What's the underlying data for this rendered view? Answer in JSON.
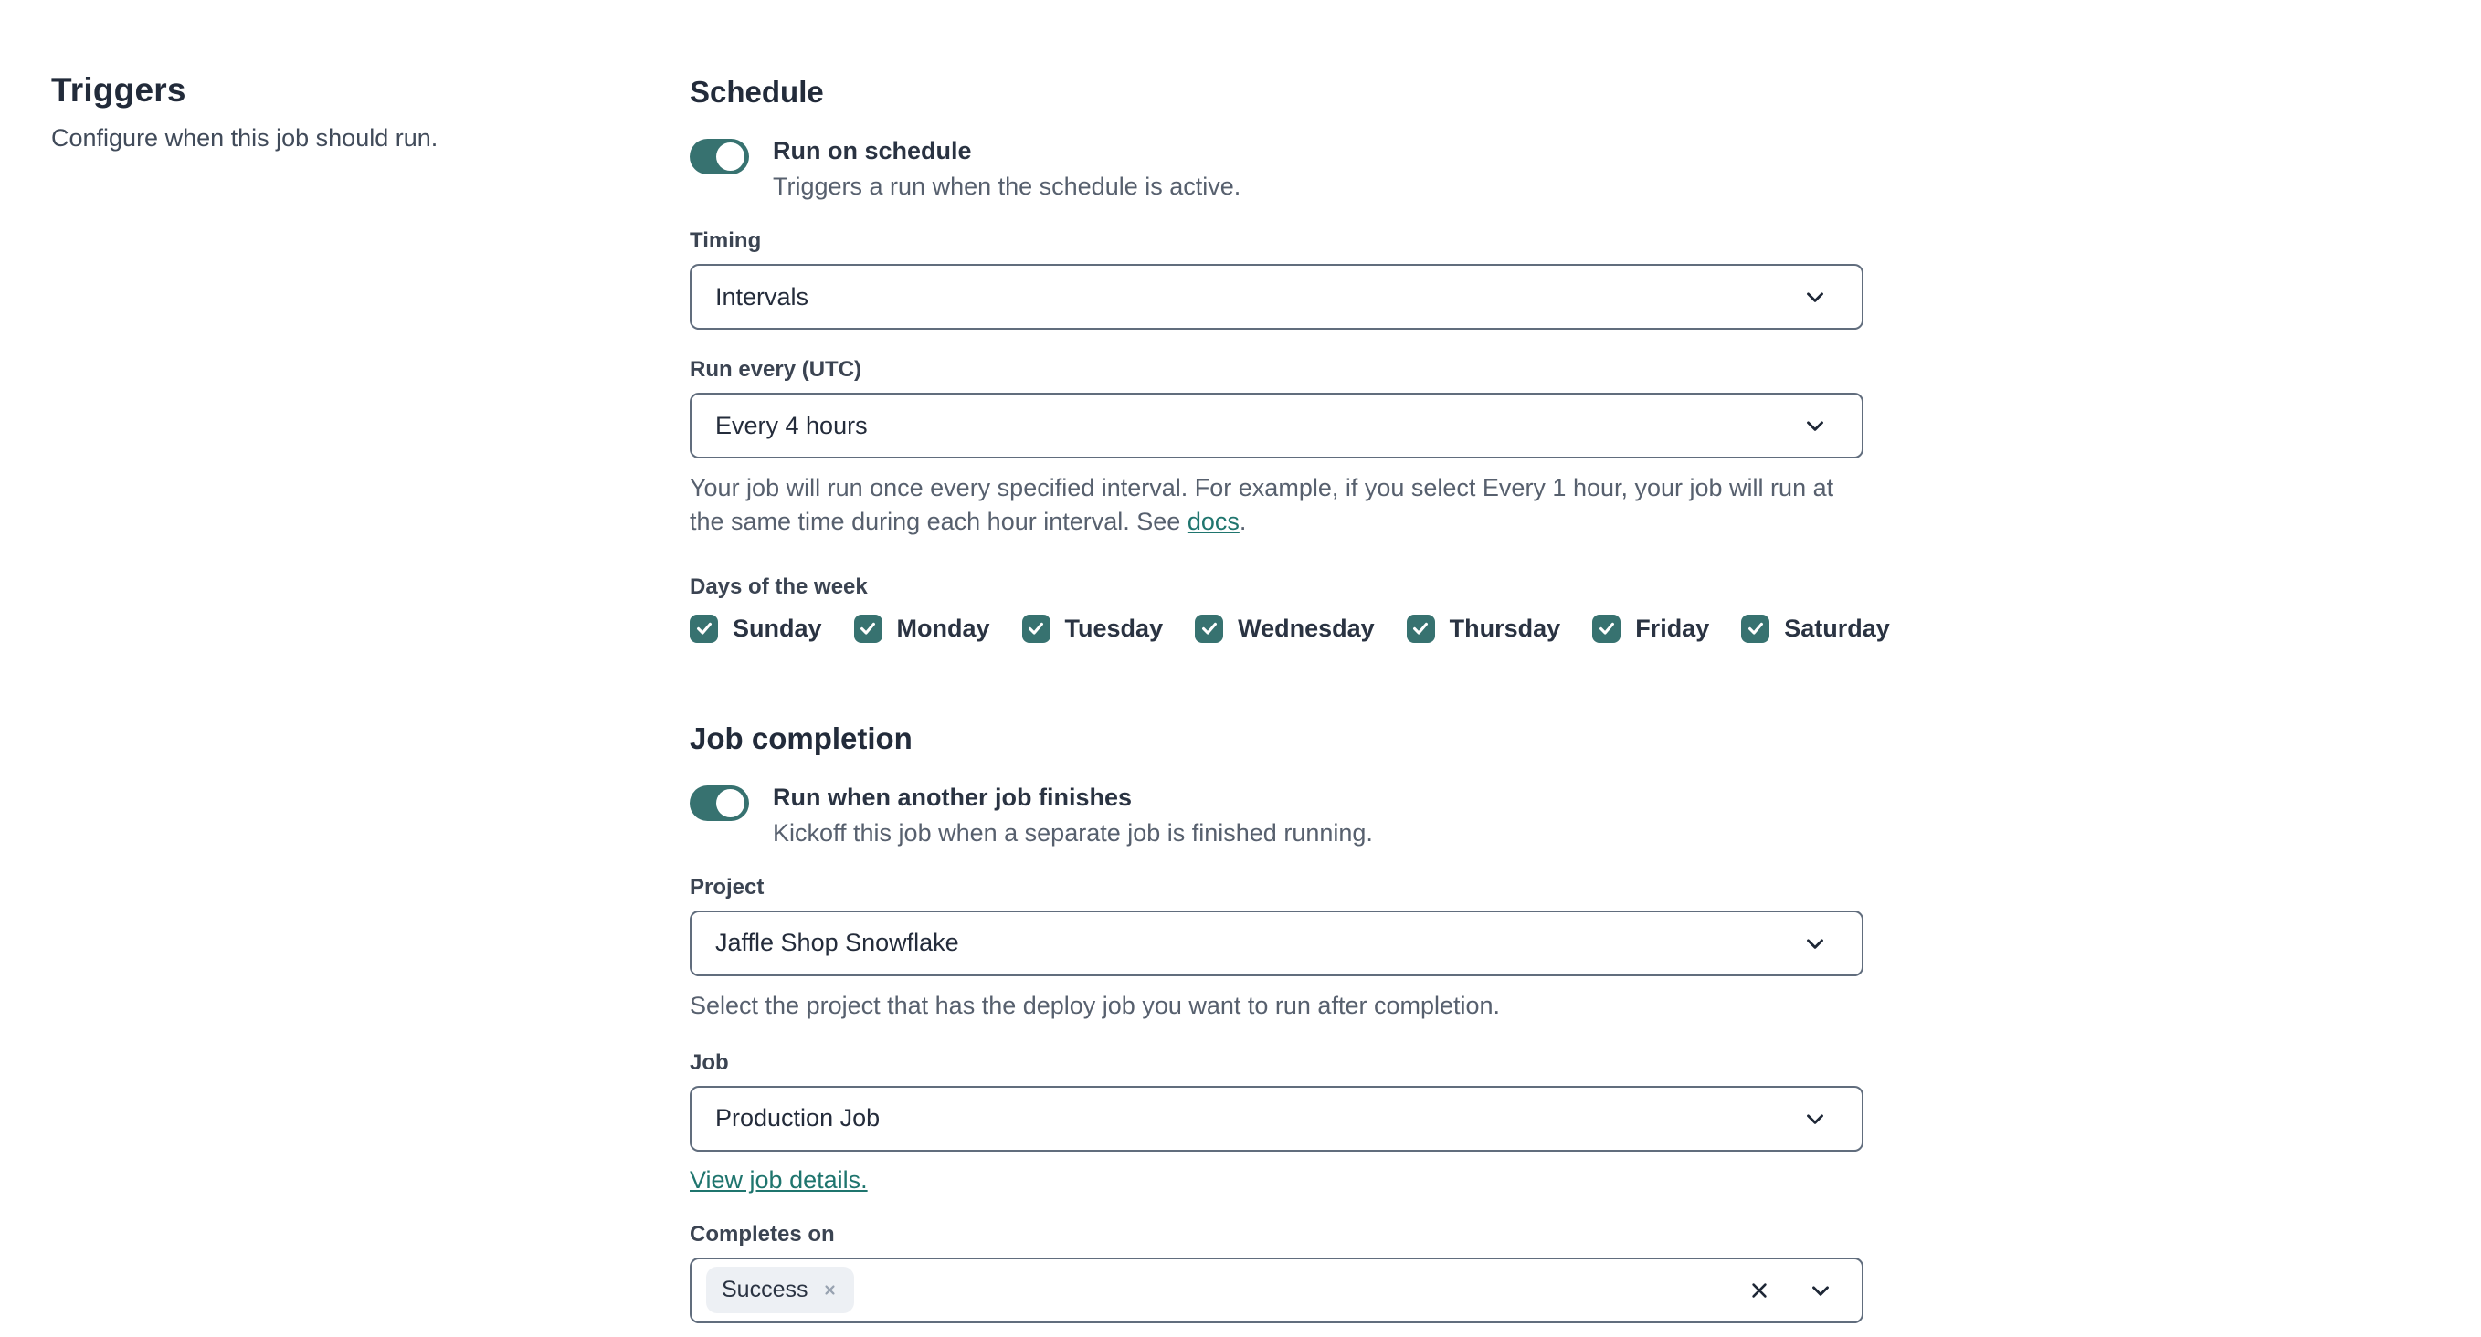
{
  "left": {
    "title": "Triggers",
    "description": "Configure when this job should run."
  },
  "schedule": {
    "heading": "Schedule",
    "toggle": {
      "label": "Run on schedule",
      "description": "Triggers a run when the schedule is active.",
      "state": "on"
    },
    "timing": {
      "label": "Timing",
      "value": "Intervals"
    },
    "run_every": {
      "label": "Run every (UTC)",
      "value": "Every 4 hours",
      "help_text": "Your job will run once every specified interval. For example, if you select Every 1 hour, your job will run at the same time during each hour interval. See ",
      "help_link_text": "docs",
      "help_suffix": "."
    },
    "days": {
      "label": "Days of the week",
      "items": [
        {
          "label": "Sunday",
          "checked": true
        },
        {
          "label": "Monday",
          "checked": true
        },
        {
          "label": "Tuesday",
          "checked": true
        },
        {
          "label": "Wednesday",
          "checked": true
        },
        {
          "label": "Thursday",
          "checked": true
        },
        {
          "label": "Friday",
          "checked": true
        },
        {
          "label": "Saturday",
          "checked": true
        }
      ]
    }
  },
  "job_completion": {
    "heading": "Job completion",
    "toggle": {
      "label": "Run when another job finishes",
      "description": "Kickoff this job when a separate job is finished running.",
      "state": "on"
    },
    "project": {
      "label": "Project",
      "value": "Jaffle Shop Snowflake",
      "help": "Select the project that has the deploy job you want to run after completion."
    },
    "job": {
      "label": "Job",
      "value": "Production Job",
      "link": "View job details."
    },
    "completes_on": {
      "label": "Completes on",
      "selected_tags": [
        {
          "label": "Success"
        }
      ]
    }
  },
  "colors": {
    "accent_teal": "#377270",
    "link_teal": "#1f756e",
    "heading_navy": "#222b3a",
    "body_gray": "#57606e",
    "border_gray": "#616d7d",
    "tag_bg": "#edf0f4"
  }
}
